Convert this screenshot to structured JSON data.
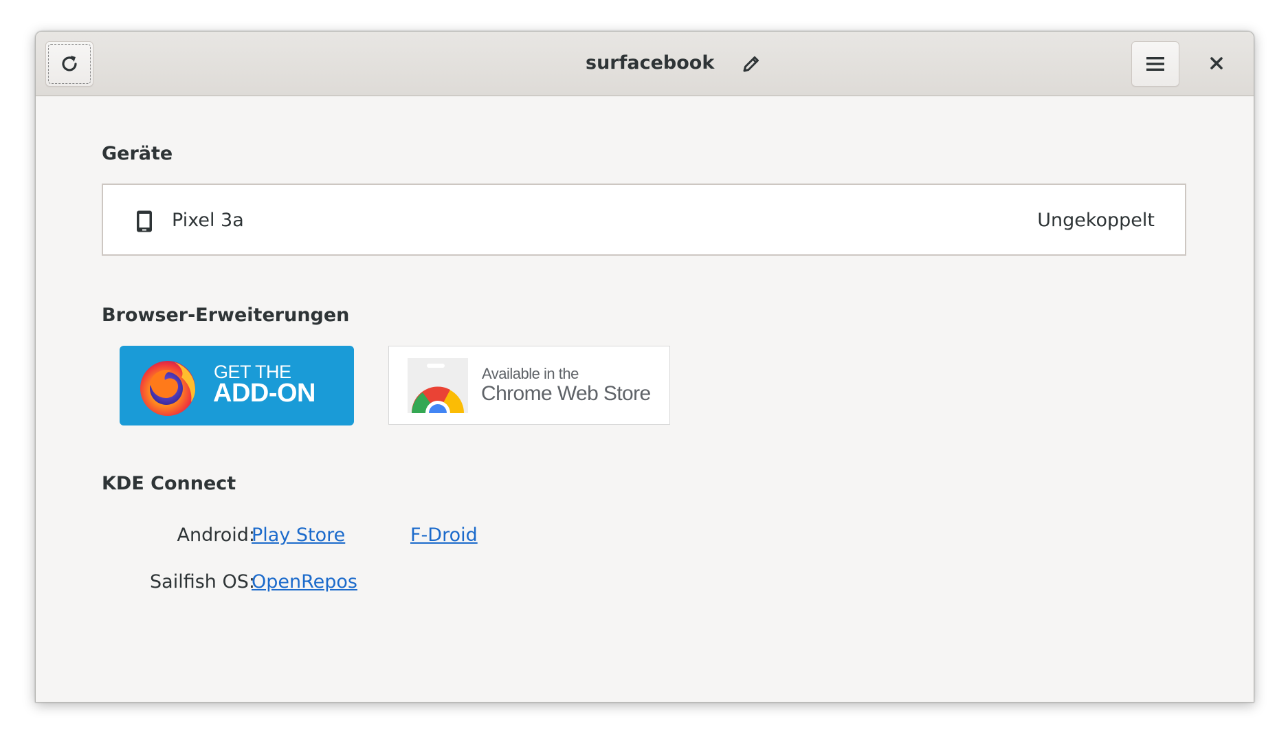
{
  "window": {
    "title": "surfacebook"
  },
  "header": {
    "refresh_icon": "refresh-icon",
    "edit_icon": "pencil-icon",
    "menu_icon": "hamburger-menu-icon",
    "close_icon": "close-icon"
  },
  "devices": {
    "heading": "Geräte",
    "items": [
      {
        "name": "Pixel 3a",
        "status": "Ungekoppelt",
        "icon": "smartphone-icon"
      }
    ]
  },
  "browser_extensions": {
    "heading": "Browser-Erweiterungen",
    "firefox": {
      "line1": "GET THE",
      "line2": "ADD-ON",
      "logo": "firefox-logo"
    },
    "chrome": {
      "line1": "Available in the",
      "line2": "Chrome Web Store",
      "logo": "chrome-logo"
    }
  },
  "kde_connect": {
    "heading": "KDE Connect",
    "rows": [
      {
        "label": "Android:",
        "links": [
          "Play Store",
          "F-Droid"
        ]
      },
      {
        "label": "Sailfish OS:",
        "links": [
          "OpenRepos"
        ]
      }
    ]
  },
  "colors": {
    "link": "#1b6acb",
    "firefox_badge": "#1a9bd7",
    "window_bg": "#f6f5f4"
  }
}
